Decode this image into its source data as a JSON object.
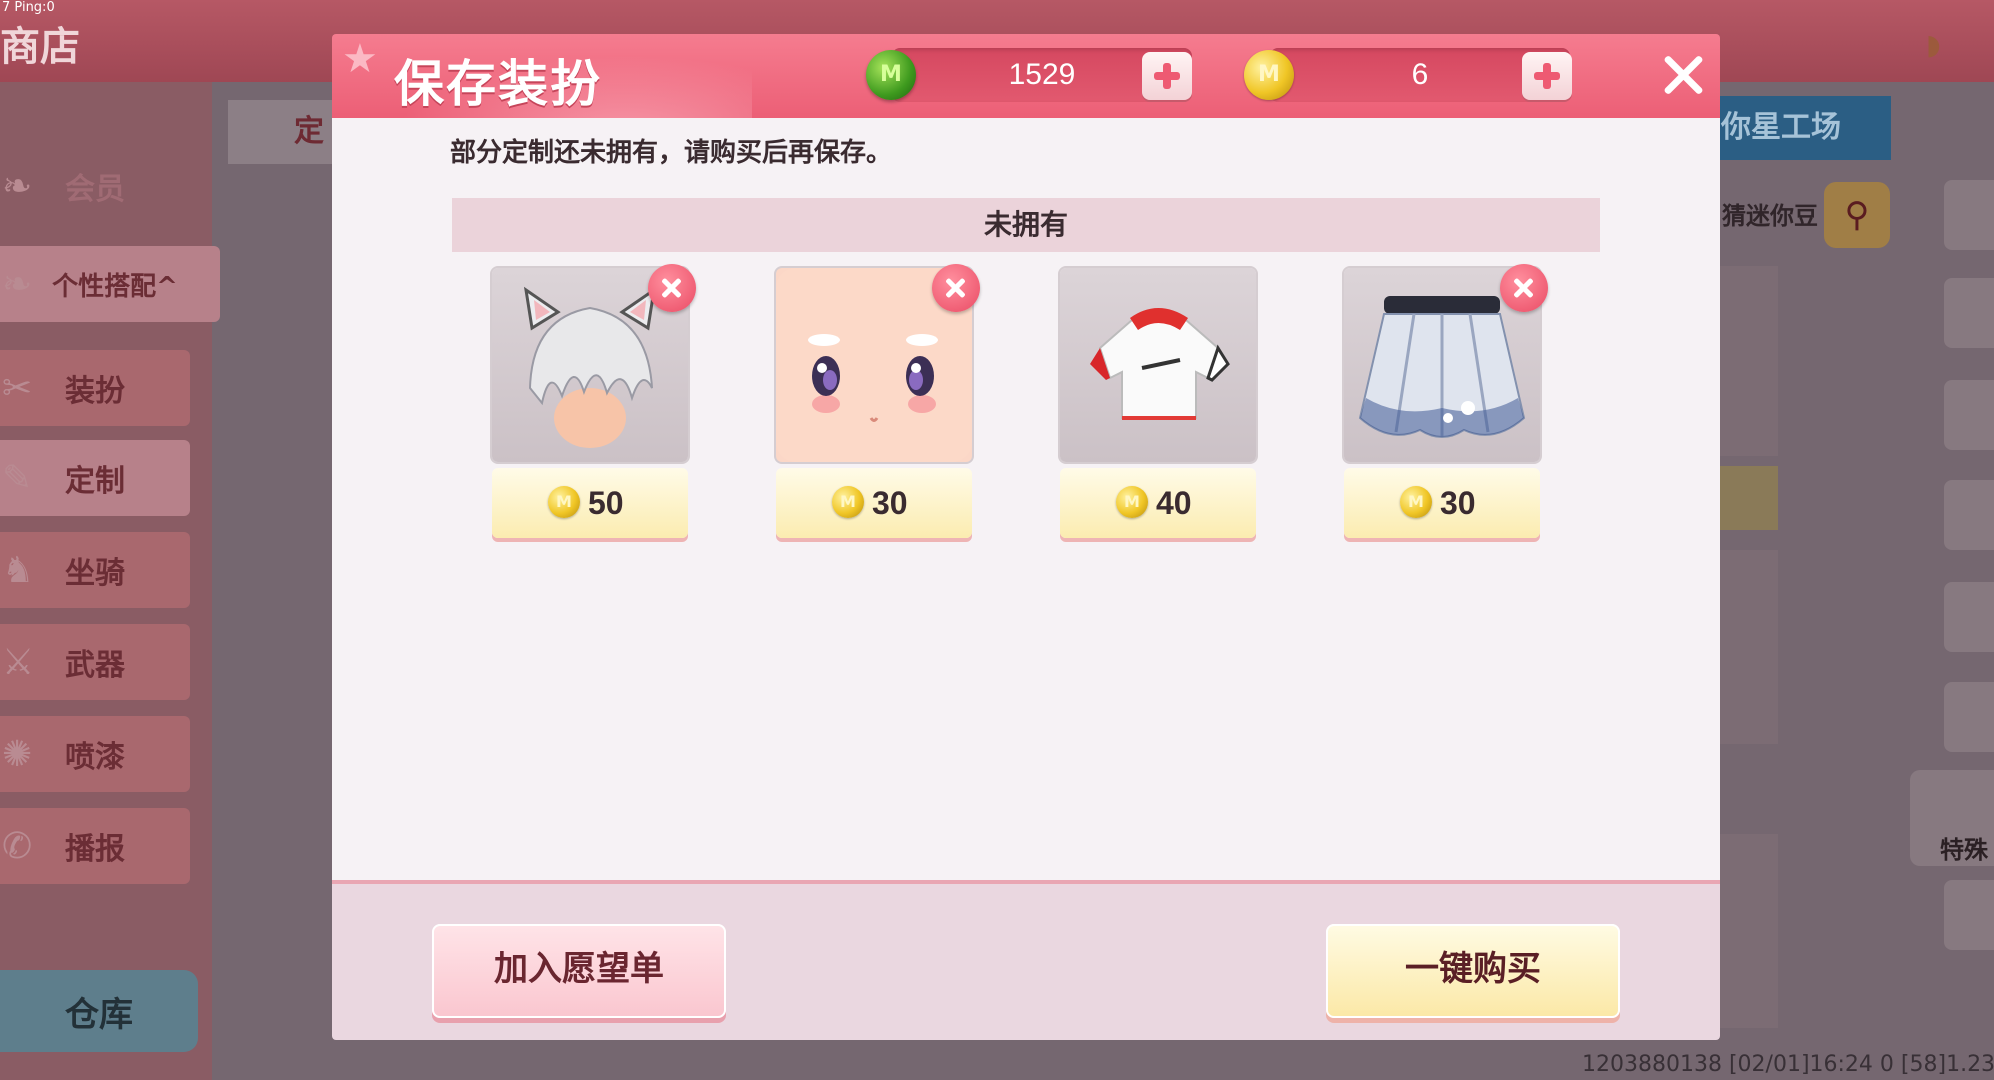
{
  "status": {
    "ping": "7 Ping:0",
    "footer": "1203880138   [02/01]16:24 0   [58]1.23.0"
  },
  "shop": {
    "title": "商店",
    "tab_label": "定",
    "right_panel_label": "你星工场",
    "search_text": "猜迷你豆",
    "special_label": "特殊",
    "sidebar": [
      {
        "label": "会员"
      },
      {
        "label": "个性搭配^"
      },
      {
        "label": "装扮"
      },
      {
        "label": "定制"
      },
      {
        "label": "坐骑"
      },
      {
        "label": "武器"
      },
      {
        "label": "喷漆"
      },
      {
        "label": "播报"
      }
    ],
    "warehouse_label": "仓库"
  },
  "dialog": {
    "title": "保存装扮",
    "gem_balance": "1529",
    "coin_balance": "6",
    "message": "部分定制还未拥有，请购买后再保存。",
    "section_title": "未拥有",
    "items": [
      {
        "price": "50",
        "icon": "cat-ear-hair-icon"
      },
      {
        "price": "30",
        "icon": "face-icon"
      },
      {
        "price": "40",
        "icon": "shirt-icon"
      },
      {
        "price": "30",
        "icon": "skirt-icon"
      }
    ],
    "wishlist_label": "加入愿望单",
    "buy_all_label": "一键购买"
  },
  "colors": {
    "header": "#ec5f76",
    "body": "#f6f2f5",
    "footer": "#ead7e0",
    "coin": "#f0c626",
    "gem": "#3e9a1e"
  }
}
